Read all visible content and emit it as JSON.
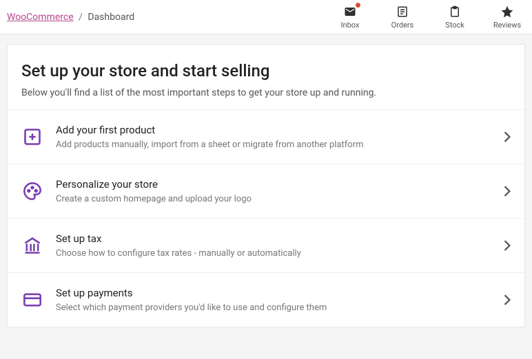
{
  "breadcrumb": {
    "root": "WooCommerce",
    "current": "Dashboard"
  },
  "topbar": {
    "items": [
      {
        "name": "inbox",
        "label": "Inbox",
        "icon": "mail-icon",
        "hasDot": true
      },
      {
        "name": "orders",
        "label": "Orders",
        "icon": "orders-icon",
        "hasDot": false
      },
      {
        "name": "stock",
        "label": "Stock",
        "icon": "clipboard-icon",
        "hasDot": false
      },
      {
        "name": "reviews",
        "label": "Reviews",
        "icon": "star-icon",
        "hasDot": false
      }
    ]
  },
  "header": {
    "title": "Set up your store and start selling",
    "subtitle": "Below you'll find a list of the most important steps to get your store up and running."
  },
  "tasks": [
    {
      "icon": "plus-box-icon",
      "title": "Add your first product",
      "desc": "Add products manually, import from a sheet or migrate from another platform"
    },
    {
      "icon": "palette-icon",
      "title": "Personalize your store",
      "desc": "Create a custom homepage and upload your logo"
    },
    {
      "icon": "bank-icon",
      "title": "Set up tax",
      "desc": "Choose how to configure tax rates - manually or automatically"
    },
    {
      "icon": "card-icon",
      "title": "Set up payments",
      "desc": "Select which payment providers you'd like to use and configure them"
    }
  ],
  "colors": {
    "accent": "#7a3eb1",
    "link": "#b54a8e"
  }
}
